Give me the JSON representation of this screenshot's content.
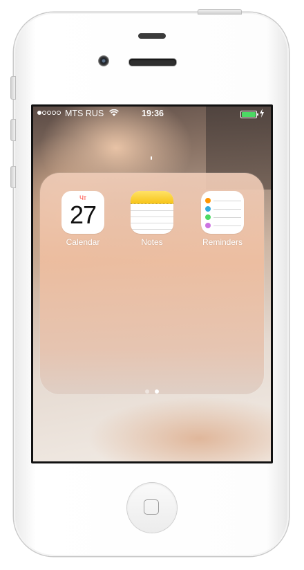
{
  "status_bar": {
    "carrier": "MTS RUS",
    "time": "19:36",
    "signal_bars_filled": 1,
    "signal_bars_total": 5,
    "battery_level": 1.0
  },
  "folder": {
    "apps": [
      {
        "label": "Calendar",
        "day_of_week": "Чт",
        "day": "27",
        "icon": "calendar-icon"
      },
      {
        "label": "Notes",
        "icon": "notes-icon"
      },
      {
        "label": "Reminders",
        "icon": "reminders-icon"
      }
    ],
    "page_count": 2,
    "current_page": 2
  },
  "colors": {
    "calendar_accent": "#ff3b30",
    "notes_header": "#f7c51a",
    "battery_fill": "#4cd964",
    "reminder_dots": [
      "#ff9500",
      "#34aadc",
      "#4cd964",
      "#cc73e1"
    ]
  }
}
